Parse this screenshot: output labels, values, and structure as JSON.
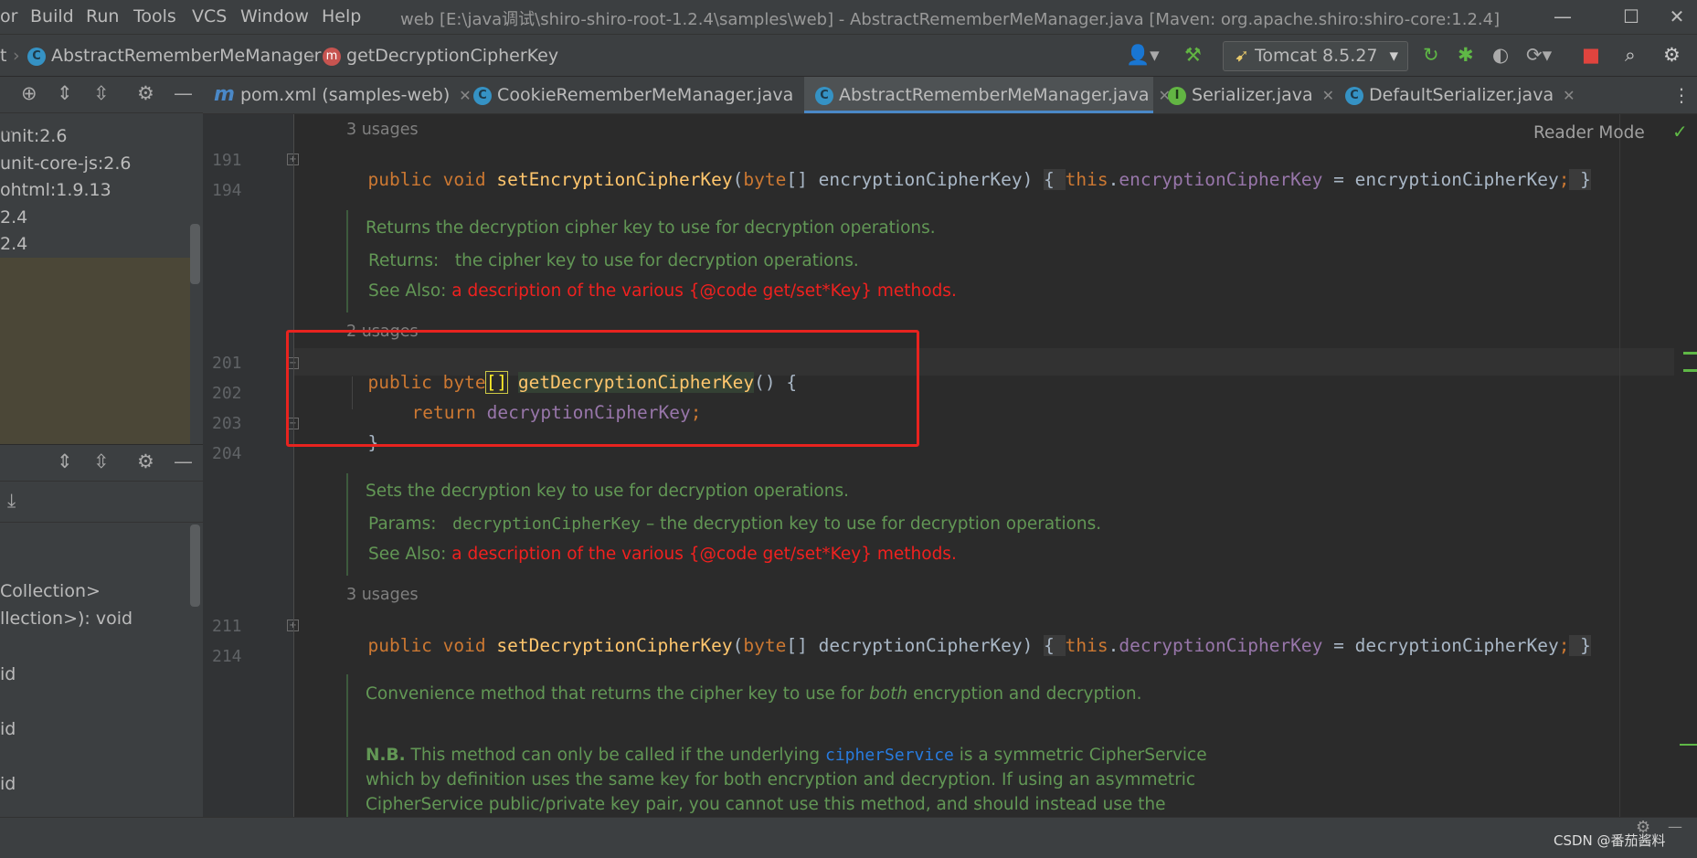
{
  "menubar": {
    "items": [
      "or",
      "Build",
      "Run",
      "Tools",
      "VCS",
      "Window",
      "Help"
    ],
    "window_title": "web [E:\\java调试\\shiro-shiro-root-1.2.4\\samples\\web] - AbstractRememberMeManager.java [Maven: org.apache.shiro:shiro-core:1.2.4]",
    "minimize": "—",
    "maximize": "☐",
    "close": "✕"
  },
  "navbar": {
    "crumb0": "t",
    "crumb1": "AbstractRememberMeManager",
    "crumb2": "getDecryptionCipherKey",
    "run_config": "Tomcat 8.5.27"
  },
  "leftpanel": {
    "tree": [
      "unit:2.6",
      "unit-core-js:2.6",
      "ohtml:1.9.13",
      "2.4",
      "2.4"
    ],
    "structure": [
      "Collection>",
      "llection>): void",
      "id",
      "id",
      "id"
    ]
  },
  "tabs": [
    {
      "label": "pom.xml (samples-web)",
      "icon": "m"
    },
    {
      "label": "CookieRememberMeManager.java",
      "icon": "c"
    },
    {
      "label": "AbstractRememberMeManager.java",
      "icon": "c"
    },
    {
      "label": "Serializer.java",
      "icon": "i"
    },
    {
      "label": "DefaultSerializer.java",
      "icon": "c"
    }
  ],
  "editor": {
    "reader_mode": "Reader Mode",
    "line_numbers": [
      "191",
      "194",
      "201",
      "202",
      "203",
      "204",
      "211",
      "214"
    ],
    "usage1": "3 usages",
    "usage2": "2 usages",
    "usage3": "3 usages",
    "set_enc": {
      "mods": "public void ",
      "name": "setEncryptionCipherKey",
      "p1": "(",
      "ptype": "byte",
      "p2": "[] encryptionCipherKey) ",
      "brace_open": "{ ",
      "this_kw": "this",
      "dot": ".",
      "field": "encryptionCipherKey",
      "assign": " = encryptionCipherKey",
      "semi": ";",
      "brace_close": " }"
    },
    "doc1": {
      "desc": "Returns the decryption cipher key to use for decryption operations.",
      "returns_label": "Returns:",
      "returns_text": "the cipher key to use for decryption operations.",
      "see_label": "See Also:",
      "see_text": "a description of the various {@code get/set*Key} methods."
    },
    "get_dec": {
      "mods": "public ",
      "type": "byte",
      "brackets": "[]",
      "name": "getDecryptionCipherKey",
      "rest": "() {",
      "ret_kw": "return ",
      "field": "decryptionCipherKey",
      "semi": ";",
      "close": "}"
    },
    "doc2": {
      "desc": "Sets the decryption key to use for decryption operations.",
      "params_label": "Params:",
      "params_code": "decryptionCipherKey",
      "params_text": " – the decryption key to use for decryption operations.",
      "see_label": "See Also:",
      "see_text": "a description of the various {@code get/set*Key} methods."
    },
    "set_dec": {
      "mods": "public void ",
      "name": "setDecryptionCipherKey",
      "p1": "(",
      "ptype": "byte",
      "p2": "[] decryptionCipherKey) ",
      "brace_open": "{ ",
      "this_kw": "this",
      "dot": ".",
      "field": "decryptionCipherKey",
      "assign": " = decryptionCipherKey",
      "semi": ";",
      "brace_close": " }"
    },
    "doc3": {
      "l1a": "Convenience method that returns the cipher key to use for ",
      "l1b": "both",
      "l1c": " encryption and decryption.",
      "nb": "N.B.",
      "l2a": " This method can only be called if the underlying ",
      "l2b": "cipherService",
      "l2c": " is a symmetric CipherService",
      "l3": "which by definition uses the same key for both encryption and decryption. If using an asymmetric",
      "l4": "CipherService public/private key pair, you cannot use this method, and should instead use the"
    }
  },
  "watermark": "CSDN @番茄酱料"
}
